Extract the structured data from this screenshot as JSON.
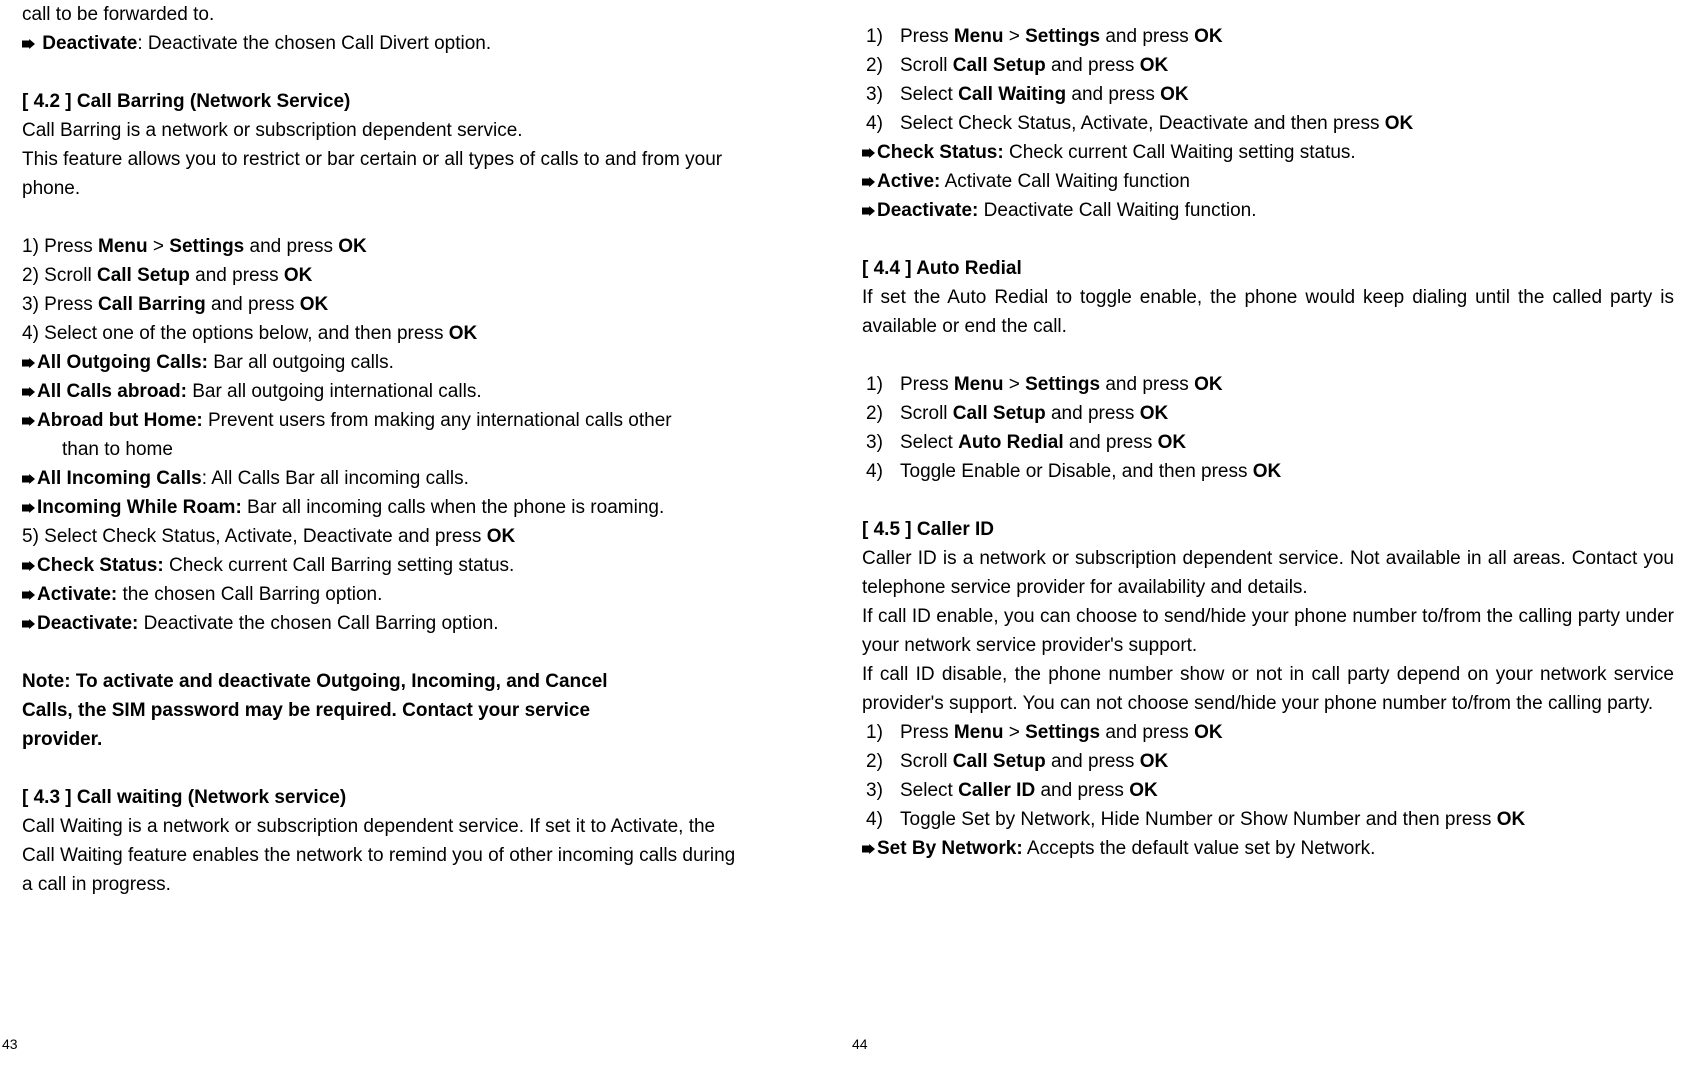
{
  "left": {
    "top_line": "call to be forwarded to.",
    "deactivate_label": "Deactivate",
    "deactivate_desc": ": Deactivate the chosen Call Divert option.",
    "s42_head": "[ 4.2 ]    Call Barring (Network Service)",
    "s42_p1": "Call Barring is a network or subscription dependent service.",
    "s42_p2": "This feature allows you to restrict or bar certain or all types of calls to and from your phone.",
    "s42_step1_a": "1) Press ",
    "s42_step1_b": "Menu",
    "s42_step1_c": " > ",
    "s42_step1_d": "Settings",
    "s42_step1_e": " and press ",
    "s42_step1_f": "OK",
    "s42_step2_a": "2) Scroll ",
    "s42_step2_b": "Call Setup",
    "s42_step2_c": " and press ",
    "s42_step2_d": "OK",
    "s42_step3_a": "3) Press ",
    "s42_step3_b": "Call Barring",
    "s42_step3_c": " and press ",
    "s42_step3_d": "OK",
    "s42_step4_a": "4) Select one of the options below, and then press ",
    "s42_step4_b": "OK",
    "b_out_l": "All Outgoing Calls:",
    "b_out_d": " Bar all outgoing calls.",
    "b_abroad_l": "All Calls abroad:",
    "b_abroad_d": " Bar all outgoing international calls.",
    "b_home_l": "Abroad but Home:",
    "b_home_d": " Prevent users from making any international calls other",
    "b_home_d2": "than to home",
    "b_in_l": "All Incoming Calls",
    "b_in_d": ": All Calls Bar all incoming calls.",
    "b_roam_l": "Incoming While Roam:",
    "b_roam_d": " Bar all incoming calls when the phone is roaming.",
    "s42_step5_a": "5) Select Check Status, Activate, Deactivate and press ",
    "s42_step5_b": "OK",
    "b_cs_l": "Check Status:",
    "b_cs_d": " Check current Call Barring setting status.",
    "b_act_l": "Activate:",
    "b_act_d": " the chosen Call Barring option.",
    "b_deact_l": "Deactivate:",
    "b_deact_d": " Deactivate the chosen Call Barring option.",
    "note1": "Note: To activate and deactivate Outgoing, Incoming, and Cancel",
    "note2": "Calls, the SIM password may be required. Contact your service",
    "note3": "provider.",
    "s43_head": "[ 4.3 ]    Call waiting (Network service)",
    "s43_p": "Call Waiting is a network or subscription dependent service. If set it to Activate, the Call Waiting feature enables the network to remind you of other incoming calls during a call in progress.",
    "pgnum": "43"
  },
  "right": {
    "s43_s1_n": "1)",
    "s43_s1_a": "Press ",
    "s43_s1_b": "Menu",
    "s43_s1_c": " > ",
    "s43_s1_d": "Settings",
    "s43_s1_e": " and press ",
    "s43_s1_f": "OK",
    "s43_s2_n": "2)",
    "s43_s2_a": "Scroll ",
    "s43_s2_b": "Call Setup",
    "s43_s2_c": " and press ",
    "s43_s2_d": "OK",
    "s43_s3_n": "3)",
    "s43_s3_a": "Select ",
    "s43_s3_b": "Call Waiting",
    "s43_s3_c": " and press ",
    "s43_s3_d": "OK",
    "s43_s4_n": "4)",
    "s43_s4_a": "Select Check Status, Activate, Deactivate and then press ",
    "s43_s4_b": "OK",
    "s43_b1_l": "Check Status:",
    "s43_b1_d": " Check current Call Waiting setting status.",
    "s43_b2_l": "Active:",
    "s43_b2_d": " Activate Call Waiting function",
    "s43_b3_l": "Deactivate:",
    "s43_b3_d": " Deactivate Call Waiting function.",
    "s44_head": "[ 4.4 ]    Auto Redial",
    "s44_p": "If set the Auto Redial to toggle enable, the phone would keep dialing until the called party is available or end the call.",
    "s44_s1_n": "1)",
    "s44_s1_a": "Press ",
    "s44_s1_b": "Menu",
    "s44_s1_c": " > ",
    "s44_s1_d": "Settings",
    "s44_s1_e": " and press ",
    "s44_s1_f": "OK",
    "s44_s2_n": "2)",
    "s44_s2_a": "Scroll ",
    "s44_s2_b": "Call Setup",
    "s44_s2_c": " and press ",
    "s44_s2_d": "OK",
    "s44_s3_n": "3)",
    "s44_s3_a": "Select ",
    "s44_s3_b": "Auto Redial",
    "s44_s3_c": " and press ",
    "s44_s3_d": "OK",
    "s44_s4_n": "4)",
    "s44_s4_a": "Toggle Enable or Disable, and then press ",
    "s44_s4_b": "OK",
    "s45_head": "[ 4.5 ]    Caller ID",
    "s45_p1": "Caller ID is a network or subscription dependent service. Not available in all areas. Contact you telephone service provider for availability and details.",
    "s45_p2": "If call ID enable, you can choose to send/hide your phone number to/from the calling party under your network service provider's support.",
    "s45_p3": "If call ID disable, the phone number show or not in call party depend on your network service provider's support. You can not choose send/hide your phone number to/from the calling party.",
    "s45_s1_n": "1)",
    "s45_s1_a": "Press ",
    "s45_s1_b": "Menu",
    "s45_s1_c": " > ",
    "s45_s1_d": "Settings",
    "s45_s1_e": " and press ",
    "s45_s1_f": "OK",
    "s45_s2_n": "2)",
    "s45_s2_a": "Scroll ",
    "s45_s2_b": "Call Setup",
    "s45_s2_c": " and press ",
    "s45_s2_d": "OK",
    "s45_s3_n": "3)",
    "s45_s3_a": "Select ",
    "s45_s3_b": "Caller ID",
    "s45_s3_c": " and press ",
    "s45_s3_d": "OK",
    "s45_s4_n": "4)",
    "s45_s4_a": "Toggle Set by Network, Hide Number or Show Number and then press ",
    "s45_s4_b": "OK",
    "s45_b1_l": "Set By Network:",
    "s45_b1_d": " Accepts the default value set by Network.",
    "pgnum": "44"
  }
}
